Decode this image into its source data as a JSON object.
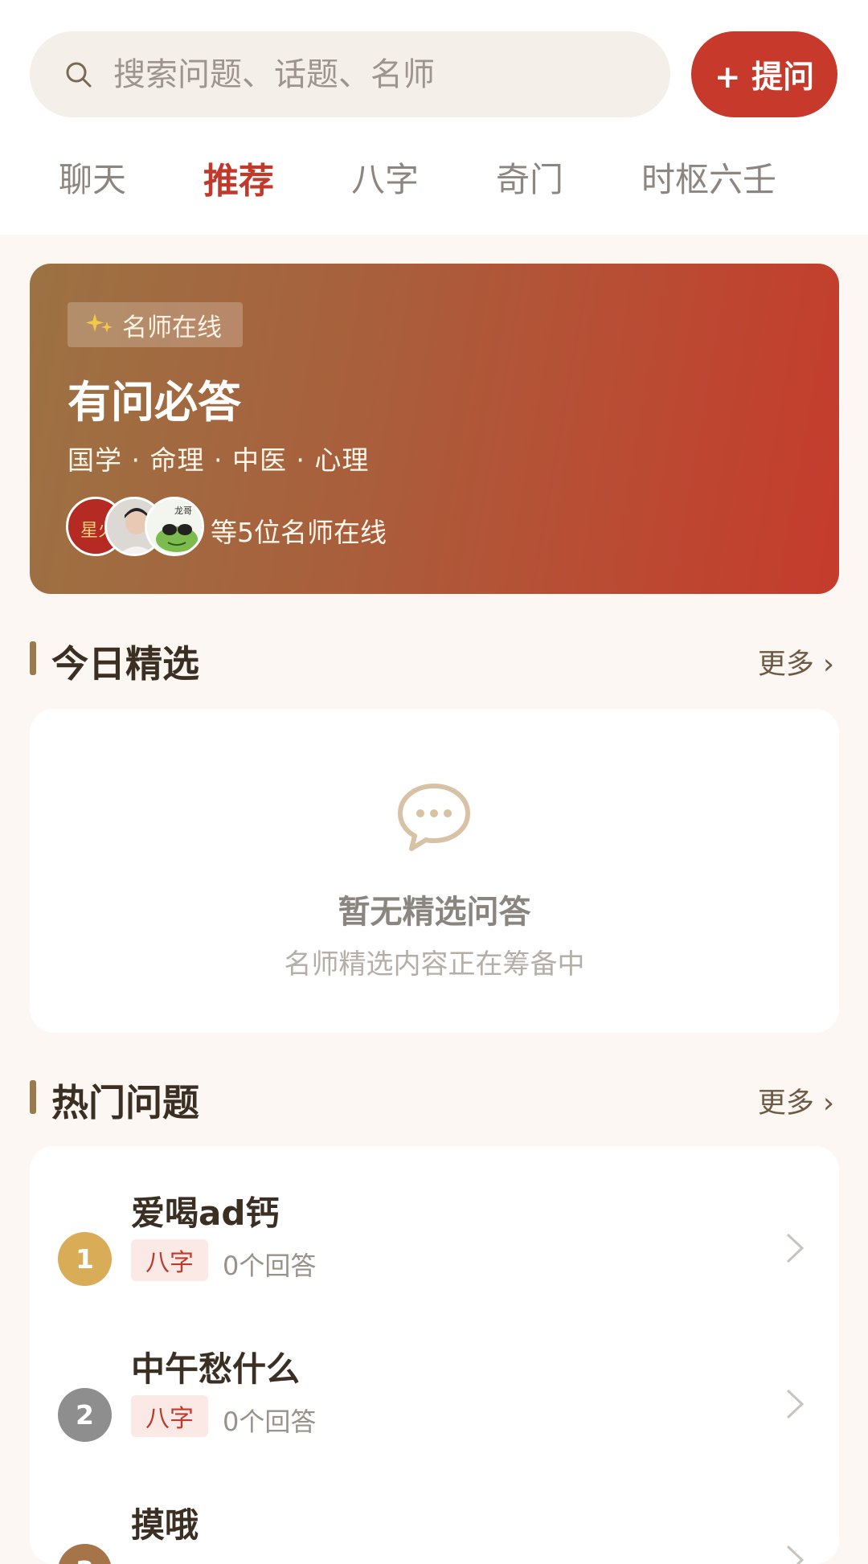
{
  "search": {
    "placeholder": "搜索问题、话题、名师",
    "icon": "search-icon"
  },
  "ask_button": {
    "label": "+ 提问"
  },
  "tabs": [
    {
      "label": "聊天",
      "active": false
    },
    {
      "label": "推荐",
      "active": true
    },
    {
      "label": "八字",
      "active": false
    },
    {
      "label": "奇门",
      "active": false
    },
    {
      "label": "时枢六壬",
      "active": false
    }
  ],
  "banner": {
    "badge_icon": "sparkles-icon",
    "badge": "名师在线",
    "title": "有问必答",
    "subtitle": "国学 · 命理 · 中医 · 心理",
    "online_text": "等5位名师在线",
    "avatar_1_text": "星火",
    "avatar_3_text": "龙哥"
  },
  "featured": {
    "title": "今日精选",
    "more": "更多 ›",
    "empty_icon": "chat-bubble-icon",
    "empty_title": "暂无精选问答",
    "empty_subtitle": "名师精选内容正在筹备中"
  },
  "hot": {
    "title": "热门问题",
    "more": "更多 ›",
    "items": [
      {
        "rank": "1",
        "title": "爱喝ad钙",
        "tag": "八字",
        "answers": "0个回答",
        "rank_color": "#d9ac57"
      },
      {
        "rank": "2",
        "title": "中午愁什么",
        "tag": "八字",
        "answers": "0个回答",
        "rank_color": "#8e8e8e"
      },
      {
        "rank": "3",
        "title": "摸哦",
        "tag": "",
        "answers": "",
        "rank_color": "#a57449"
      }
    ]
  },
  "colors": {
    "accent": "#c6392b",
    "tab_active": "#c0392b",
    "section_bar": "#9a7a4c"
  }
}
